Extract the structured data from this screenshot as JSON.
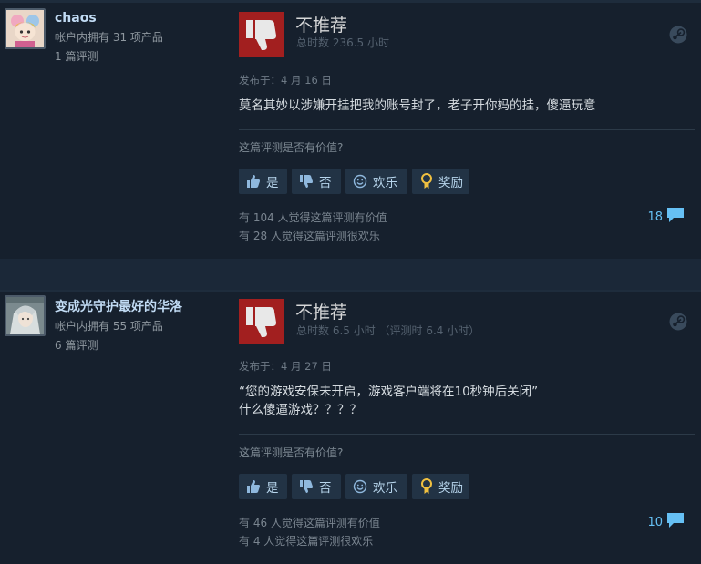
{
  "reviews": [
    {
      "author": {
        "name": "chaos",
        "products": "帐户内拥有 31 项产品",
        "reviews": "1 篇评测"
      },
      "verdict": "不推荐",
      "hours": "总时数 236.5 小时",
      "posted": "发布于：4 月 16 日",
      "content": [
        "莫名其妙以涉嫌开挂把我的账号封了，老子开你妈的挂，傻逼玩意"
      ],
      "helpful_question": "这篇评测是否有价值?",
      "buttons": {
        "yes": "是",
        "no": "否",
        "funny": "欢乐",
        "award": "奖励"
      },
      "votes_helpful": "有 104 人觉得这篇评测有价值",
      "votes_funny": "有 28 人觉得这篇评测很欢乐",
      "comment_count": "18"
    },
    {
      "author": {
        "name": "变成光守护最好的华洛",
        "products": "帐户内拥有 55 项产品",
        "reviews": "6 篇评测"
      },
      "verdict": "不推荐",
      "hours": "总时数 6.5 小时 （评测时 6.4 小时）",
      "posted": "发布于：4 月 27 日",
      "content": [
        "“您的游戏安保未开启，游戏客户端将在10秒钟后关闭”",
        "什么傻逼游戏？？？？"
      ],
      "helpful_question": "这篇评测是否有价值?",
      "buttons": {
        "yes": "是",
        "no": "否",
        "funny": "欢乐",
        "award": "奖励"
      },
      "votes_helpful": "有 46 人觉得这篇评测有价值",
      "votes_funny": "有 4 人觉得这篇评测很欢乐",
      "comment_count": "10"
    }
  ],
  "colors": {
    "thumb_down_bg": "#a21f1f",
    "author_name": "#c1dbf4",
    "comment_count": "#66c0f4",
    "page_bg": "#1b2838"
  },
  "icons": {
    "thumb_down": "thumbs-down-icon",
    "steam": "steam-logo-icon",
    "thumb_up": "thumbs-up-icon",
    "funny": "smiley-icon",
    "award": "award-medal-icon",
    "comment": "comment-bubble-icon"
  }
}
